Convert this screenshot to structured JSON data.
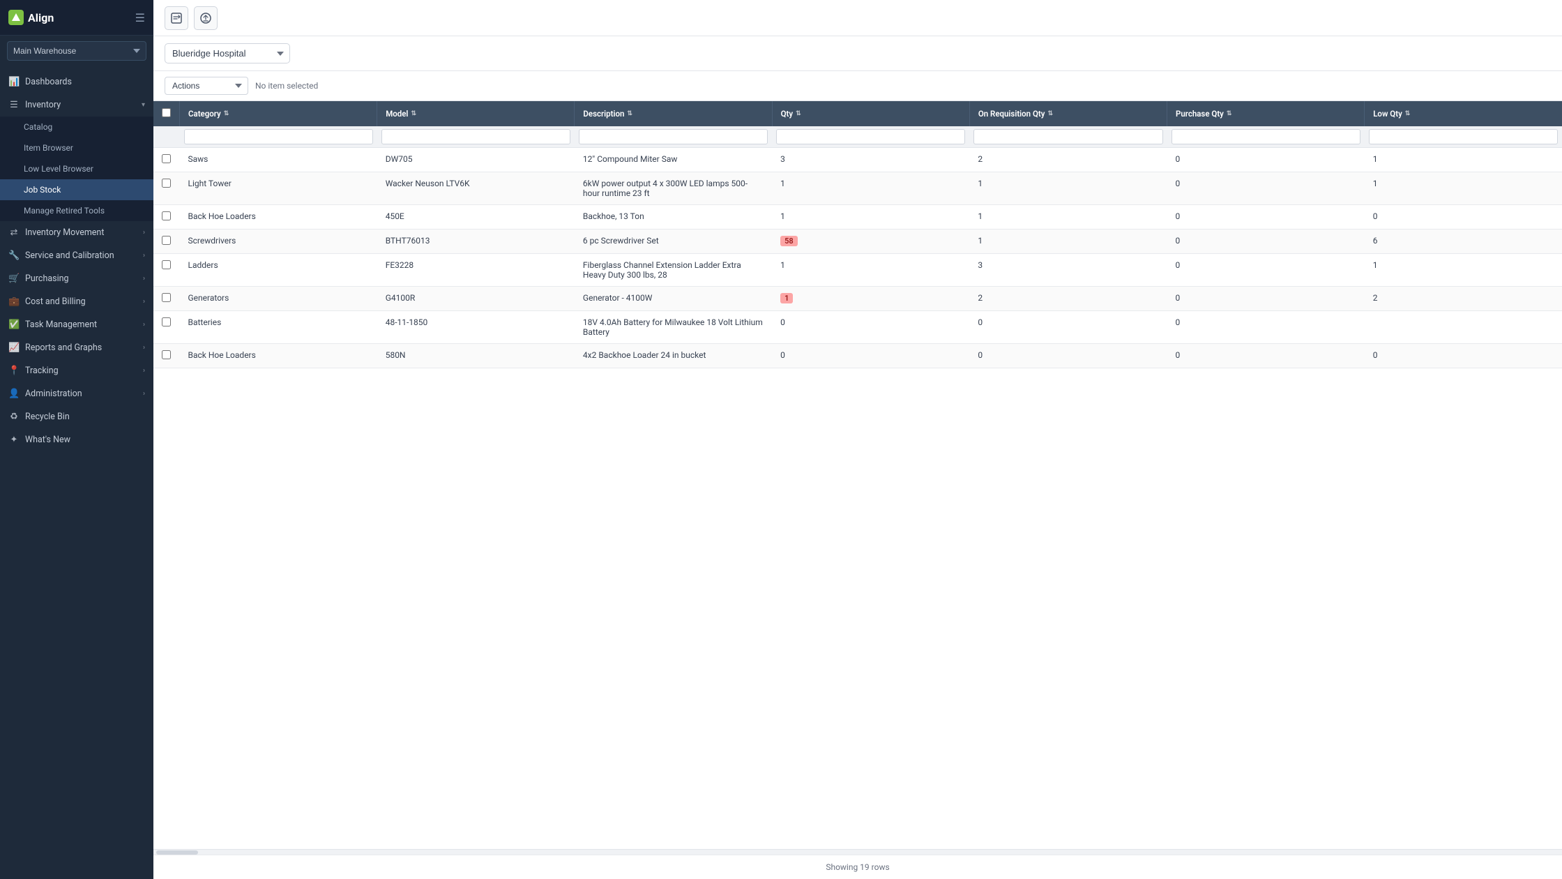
{
  "app": {
    "logo_text": "Align",
    "logo_icon": "A"
  },
  "sidebar": {
    "warehouse_label": "Main Warehouse",
    "items": [
      {
        "id": "dashboards",
        "label": "Dashboards",
        "icon": "📊",
        "has_children": false,
        "expanded": false
      },
      {
        "id": "inventory",
        "label": "Inventory",
        "icon": "📦",
        "has_children": true,
        "expanded": true,
        "children": [
          {
            "id": "catalog",
            "label": "Catalog",
            "active": false
          },
          {
            "id": "item-browser",
            "label": "Item Browser",
            "active": false
          },
          {
            "id": "low-level-browser",
            "label": "Low Level Browser",
            "active": false
          },
          {
            "id": "job-stock",
            "label": "Job Stock",
            "active": true
          },
          {
            "id": "manage-retired-tools",
            "label": "Manage Retired Tools",
            "active": false
          }
        ]
      },
      {
        "id": "inventory-movement",
        "label": "Inventory Movement",
        "icon": "🔄",
        "has_children": true,
        "expanded": false
      },
      {
        "id": "service-calibration",
        "label": "Service and Calibration",
        "icon": "🔧",
        "has_children": true,
        "expanded": false
      },
      {
        "id": "purchasing",
        "label": "Purchasing",
        "icon": "🛒",
        "has_children": true,
        "expanded": false
      },
      {
        "id": "cost-billing",
        "label": "Cost and Billing",
        "icon": "💰",
        "has_children": true,
        "expanded": false
      },
      {
        "id": "task-management",
        "label": "Task Management",
        "icon": "✅",
        "has_children": true,
        "expanded": false
      },
      {
        "id": "reports-graphs",
        "label": "Reports and Graphs",
        "icon": "📈",
        "has_children": true,
        "expanded": false
      },
      {
        "id": "tracking",
        "label": "Tracking",
        "icon": "📍",
        "has_children": true,
        "expanded": false
      },
      {
        "id": "administration",
        "label": "Administration",
        "icon": "⚙️",
        "has_children": true,
        "expanded": false
      },
      {
        "id": "recycle-bin",
        "label": "Recycle Bin",
        "icon": "🗑️",
        "has_children": false,
        "expanded": false
      },
      {
        "id": "whats-new",
        "label": "What's New",
        "icon": "🆕",
        "has_children": false,
        "expanded": false
      }
    ]
  },
  "toolbar": {
    "btn1_icon": "📋",
    "btn2_icon": "📤"
  },
  "filter_bar": {
    "location_label": "Blueridge Hospital",
    "no_item_label": ""
  },
  "actions_bar": {
    "actions_label": "Actions",
    "no_item_label": "No item selected"
  },
  "table": {
    "columns": [
      {
        "id": "category",
        "label": "Category"
      },
      {
        "id": "model",
        "label": "Model"
      },
      {
        "id": "description",
        "label": "Description"
      },
      {
        "id": "qty",
        "label": "Qty"
      },
      {
        "id": "on-req-qty",
        "label": "On Requisition Qty"
      },
      {
        "id": "purchase-qty",
        "label": "Purchase Qty"
      },
      {
        "id": "low-qty",
        "label": "Low Qty"
      }
    ],
    "rows": [
      {
        "id": 1,
        "category": "Saws",
        "model": "DW705",
        "description": "12\" Compound Miter Saw",
        "qty": "3",
        "qty_highlight": false,
        "on_req_qty": "2",
        "purchase_qty": "0",
        "low_qty": "1"
      },
      {
        "id": 2,
        "category": "Light Tower",
        "model": "Wacker Neuson LTV6K",
        "description": "6kW power output 4 x 300W LED lamps 500-hour runtime 23 ft",
        "qty": "1",
        "qty_highlight": false,
        "on_req_qty": "1",
        "purchase_qty": "0",
        "low_qty": "1"
      },
      {
        "id": 3,
        "category": "Back Hoe Loaders",
        "model": "450E",
        "description": "Backhoe, 13 Ton",
        "qty": "1",
        "qty_highlight": false,
        "on_req_qty": "1",
        "purchase_qty": "0",
        "low_qty": "0"
      },
      {
        "id": 4,
        "category": "Screwdrivers",
        "model": "BTHT76013",
        "description": "6 pc Screwdriver Set",
        "qty": "58",
        "qty_highlight": true,
        "on_req_qty": "1",
        "purchase_qty": "0",
        "low_qty": "6"
      },
      {
        "id": 5,
        "category": "Ladders",
        "model": "FE3228",
        "description": "Fiberglass Channel Extension Ladder Extra Heavy Duty 300 lbs, 28",
        "qty": "1",
        "qty_highlight": false,
        "on_req_qty": "3",
        "purchase_qty": "0",
        "low_qty": "1"
      },
      {
        "id": 6,
        "category": "Generators",
        "model": "G4100R",
        "description": "Generator - 4100W",
        "qty": "1",
        "qty_highlight": true,
        "on_req_qty": "2",
        "purchase_qty": "0",
        "low_qty": "2"
      },
      {
        "id": 7,
        "category": "Batteries",
        "model": "48-11-1850",
        "description": "18V 4.0Ah Battery for Milwaukee 18 Volt Lithium Battery",
        "qty": "0",
        "qty_highlight": false,
        "on_req_qty": "0",
        "purchase_qty": "0",
        "low_qty": ""
      },
      {
        "id": 8,
        "category": "Back Hoe Loaders",
        "model": "580N",
        "description": "4x2 Backhoe Loader 24 in bucket",
        "qty": "0",
        "qty_highlight": false,
        "on_req_qty": "0",
        "purchase_qty": "0",
        "low_qty": "0"
      }
    ],
    "footer_text": "Showing 19 rows"
  }
}
